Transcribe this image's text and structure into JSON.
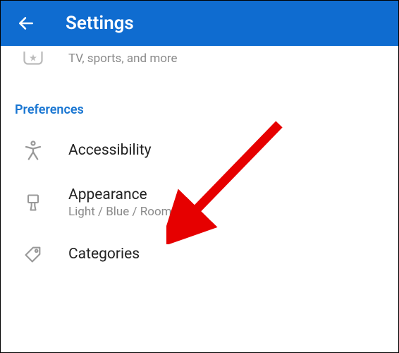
{
  "header": {
    "title": "Settings"
  },
  "partialRow": {
    "subtitle": "TV, sports, and more"
  },
  "sectionHeader": "Preferences",
  "rows": {
    "accessibility": {
      "title": "Accessibility"
    },
    "appearance": {
      "title": "Appearance",
      "subtitle": "Light / Blue / Roomy"
    },
    "categories": {
      "title": "Categories"
    }
  }
}
